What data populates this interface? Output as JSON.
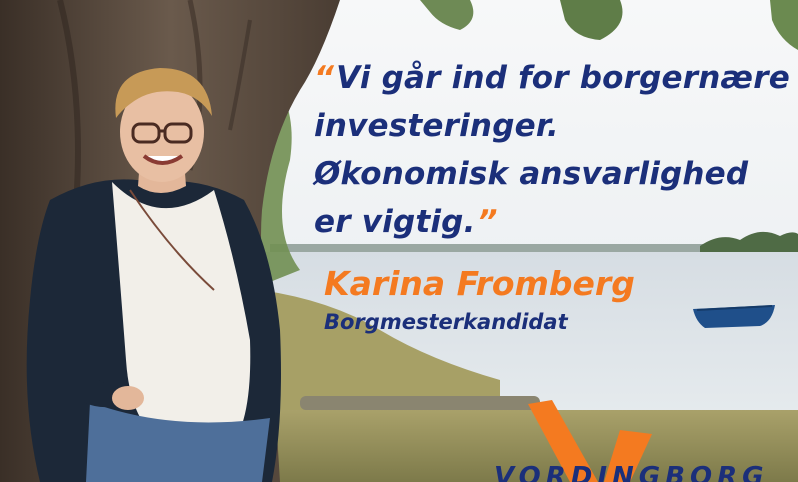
{
  "quote": {
    "open_mark": "“",
    "lines": [
      "Vi går ind for borgernære",
      "investeringer.",
      "Økonomisk ansvarlighed",
      "er vigtig."
    ],
    "close_mark": "”"
  },
  "person": {
    "name": "Karina Fromberg",
    "role": "Borgmesterkandidat"
  },
  "brand": {
    "text": "VORDINGBORG"
  },
  "colors": {
    "navy": "#1b2f7a",
    "orange": "#f47a20",
    "sky": "#f4f6f7",
    "water": "#dde4e9"
  },
  "icons": [
    "v-logo-mark",
    "rowboat"
  ]
}
